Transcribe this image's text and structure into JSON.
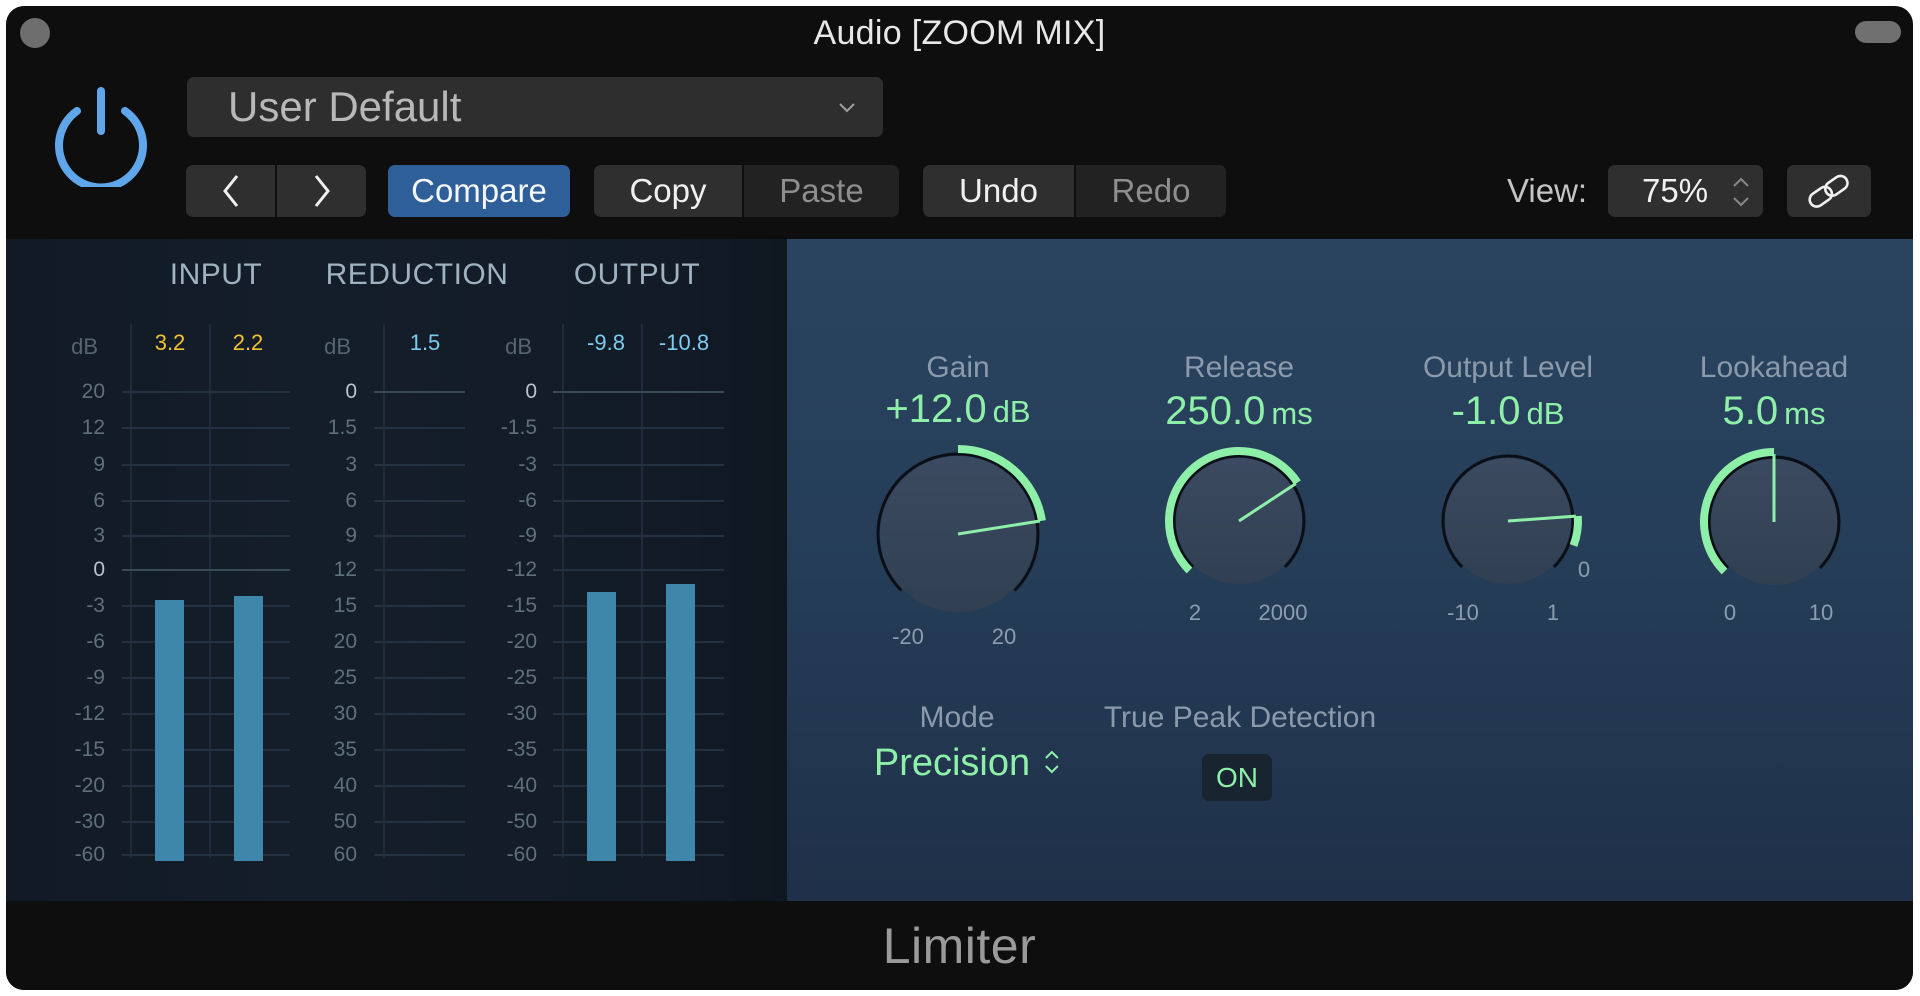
{
  "window": {
    "title": "Audio [ZOOM MIX]",
    "plugin_name": "Limiter"
  },
  "header": {
    "power_state": "on",
    "preset": {
      "selected": "User Default"
    },
    "nav": {
      "prev_icon": "chevron-left-icon",
      "next_icon": "chevron-right-icon"
    },
    "buttons": {
      "compare": "Compare",
      "copy": "Copy",
      "paste": "Paste",
      "undo": "Undo",
      "redo": "Redo"
    },
    "view": {
      "label": "View:",
      "value": "75%"
    },
    "link_icon": "link-icon"
  },
  "meters": {
    "unit_label": "dB",
    "input": {
      "title": "INPUT",
      "peak_values": [
        "3.2",
        "2.2"
      ],
      "scale": [
        "20",
        "12",
        "9",
        "6",
        "3",
        "0",
        "-3",
        "-6",
        "-9",
        "-12",
        "-15",
        "-20",
        "-30",
        "-60"
      ],
      "levels_db": [
        -2.5,
        -2.2
      ]
    },
    "reduction": {
      "title": "REDUCTION",
      "peak_values": [
        "1.5"
      ],
      "scale": [
        "0",
        "1.5",
        "3",
        "6",
        "9",
        "12",
        "15",
        "20",
        "25",
        "30",
        "35",
        "40",
        "50",
        "60"
      ]
    },
    "output": {
      "title": "OUTPUT",
      "peak_values": [
        "-9.8",
        "-10.8"
      ],
      "scale": [
        "0",
        "-1.5",
        "-3",
        "-6",
        "-9",
        "-12",
        "-15",
        "-20",
        "-25",
        "-30",
        "-35",
        "-40",
        "-50",
        "-60"
      ],
      "levels_db": [
        -13.8,
        -13.2
      ]
    },
    "colors": {
      "input_value": "#f1c232",
      "output_value": "#7ccbf0",
      "bar": "#3f86ab"
    }
  },
  "controls": {
    "knobs": [
      {
        "id": "gain",
        "label": "Gain",
        "value": "+12.0",
        "unit": "dB",
        "min_label": "-20",
        "max_label": "20",
        "min": -20,
        "max": 20,
        "current": 12,
        "origin": 0
      },
      {
        "id": "release",
        "label": "Release",
        "value": "250.0",
        "unit": "ms",
        "min_label": "2",
        "max_label": "2000",
        "min": 0,
        "max": 1,
        "current": 0.71,
        "origin": 0
      },
      {
        "id": "output-level",
        "label": "Output Level",
        "value": "-1.0",
        "unit": "dB",
        "min_label": "-10",
        "max_label": "1",
        "zero_label": "0",
        "min": -10,
        "max": 1,
        "current": -1,
        "origin": 0
      },
      {
        "id": "lookahead",
        "label": "Lookahead",
        "value": "5.0",
        "unit": "ms",
        "min_label": "0",
        "max_label": "10",
        "min": 0,
        "max": 10,
        "current": 5,
        "origin": 0
      }
    ],
    "mode": {
      "label": "Mode",
      "value": "Precision"
    },
    "true_peak": {
      "label": "True Peak Detection",
      "value": "ON"
    },
    "accent": "#8ef0a8"
  }
}
